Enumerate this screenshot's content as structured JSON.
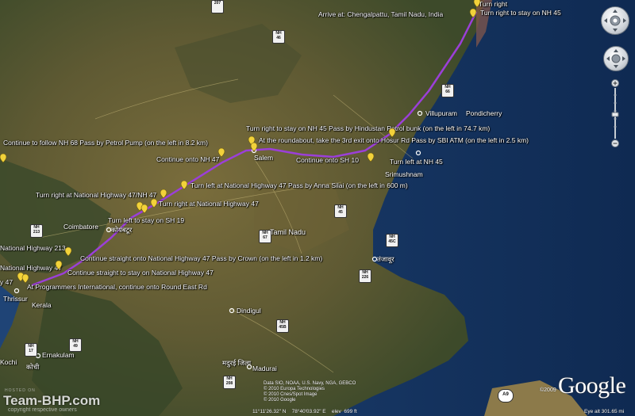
{
  "directions": {
    "turn_right_top": "Turn right",
    "arrive": "Arrive at: Chengalpattu, Tamil Nadu, India",
    "stay_nh45_top": "Turn right to stay on NH 45",
    "stay_nh45_hindustan": "Turn right to stay on NH 45  Pass by Hindustan Petrol bunk (on the left in 74.7 km)",
    "continue_nh68": "Continue to follow NH 68 Pass by Petrol Pump (on the left in 8.2 km)",
    "roundabout": "At the roundabout, take the 3rd exit onto Hosur Rd  Pass by SBI ATM (on the left in 2.5 km)",
    "continue_nh47": "Continue onto NH 47",
    "continue_sh10": "Continue onto SH 10",
    "turn_left_nh45": "Turn left at NH 45",
    "turn_left_nh47_anna": "Turn left at National Highway 47  Pass by Anna Silai (on the left in 600 m)",
    "turn_right_nh47_nh47": "Turn right at National Highway 47/NH 47",
    "turn_right_nh47": "Turn right at National Highway 47",
    "turn_left_sh19": "Turn left to stay on SH 19",
    "highway_213": "National Highway 213",
    "continue_straight_crown": "Continue straight onto National Highway 47  Pass by Crown (on the left in 1.2 km)",
    "highway_47_left": "National Highway 47",
    "continue_straight_stay": "Continue straight to stay on National Highway 47",
    "programmers": "At Programmers International, continue onto Round East Rd",
    "highway_47_partial": "y 47"
  },
  "cities": {
    "villupuram": "Villupuram",
    "pondicherry": "Pondicherry",
    "salem": "Salem",
    "srimushnam": "Srimushnam",
    "coimbatore": "Coimbatore",
    "coimbatore_local": "कोयंबटूर",
    "tamil_nadu": "Tamil Nadu",
    "thanjavur_local": "तंजावूर",
    "dindigul": "Dindigul",
    "madurai_local": "मदुरई जिला",
    "madurai": "Madurai",
    "thrissur": "Thrissur",
    "kerala": "Kerala",
    "ernakulam": "Ernakulam",
    "kochi": "Kochi",
    "kochi_local": "कोची"
  },
  "shields": [
    {
      "id": "nh207",
      "top": "",
      "num": "207"
    },
    {
      "id": "nh46",
      "top": "NH",
      "num": "46"
    },
    {
      "id": "nh66",
      "top": "NH",
      "num": "66"
    },
    {
      "id": "nh45",
      "top": "NH",
      "num": "45"
    },
    {
      "id": "nh67",
      "top": "NH",
      "num": "67"
    },
    {
      "id": "nh45c",
      "top": "NH",
      "num": "45C"
    },
    {
      "id": "nh213",
      "top": "NH",
      "num": "213"
    },
    {
      "id": "nh226",
      "top": "NH",
      "num": "226"
    },
    {
      "id": "nh45b",
      "top": "NH",
      "num": "45B"
    },
    {
      "id": "nh17",
      "top": "NH",
      "num": "17"
    },
    {
      "id": "nh49",
      "top": "NH",
      "num": "49"
    },
    {
      "id": "nh208",
      "top": "NH",
      "num": "208"
    },
    {
      "id": "a9",
      "top": "",
      "num": "A9"
    }
  ],
  "attribution": {
    "line1": "Data SIO, NOAA, U.S. Navy, NGA, GEBCO",
    "line2": "© 2010 Europa Technologies",
    "line3": "© 2010 Cnes/Spot Image",
    "line4": "© 2010 Google",
    "copyright": "©2009",
    "google": "Google",
    "coords": "11°11'26.32\" N    78°40'03.92\" E    elev  699 ft",
    "eye_alt": "Eye alt  301.65 mi"
  },
  "watermark": {
    "brand": "Team-BHP.com",
    "tagline": "copyright respective owners",
    "host": "HOSTED ON"
  },
  "colors": {
    "route": "#9b3fd8",
    "ocean": "#16305c",
    "pin": "#f2d23a",
    "brand_red": "#d4281c"
  }
}
